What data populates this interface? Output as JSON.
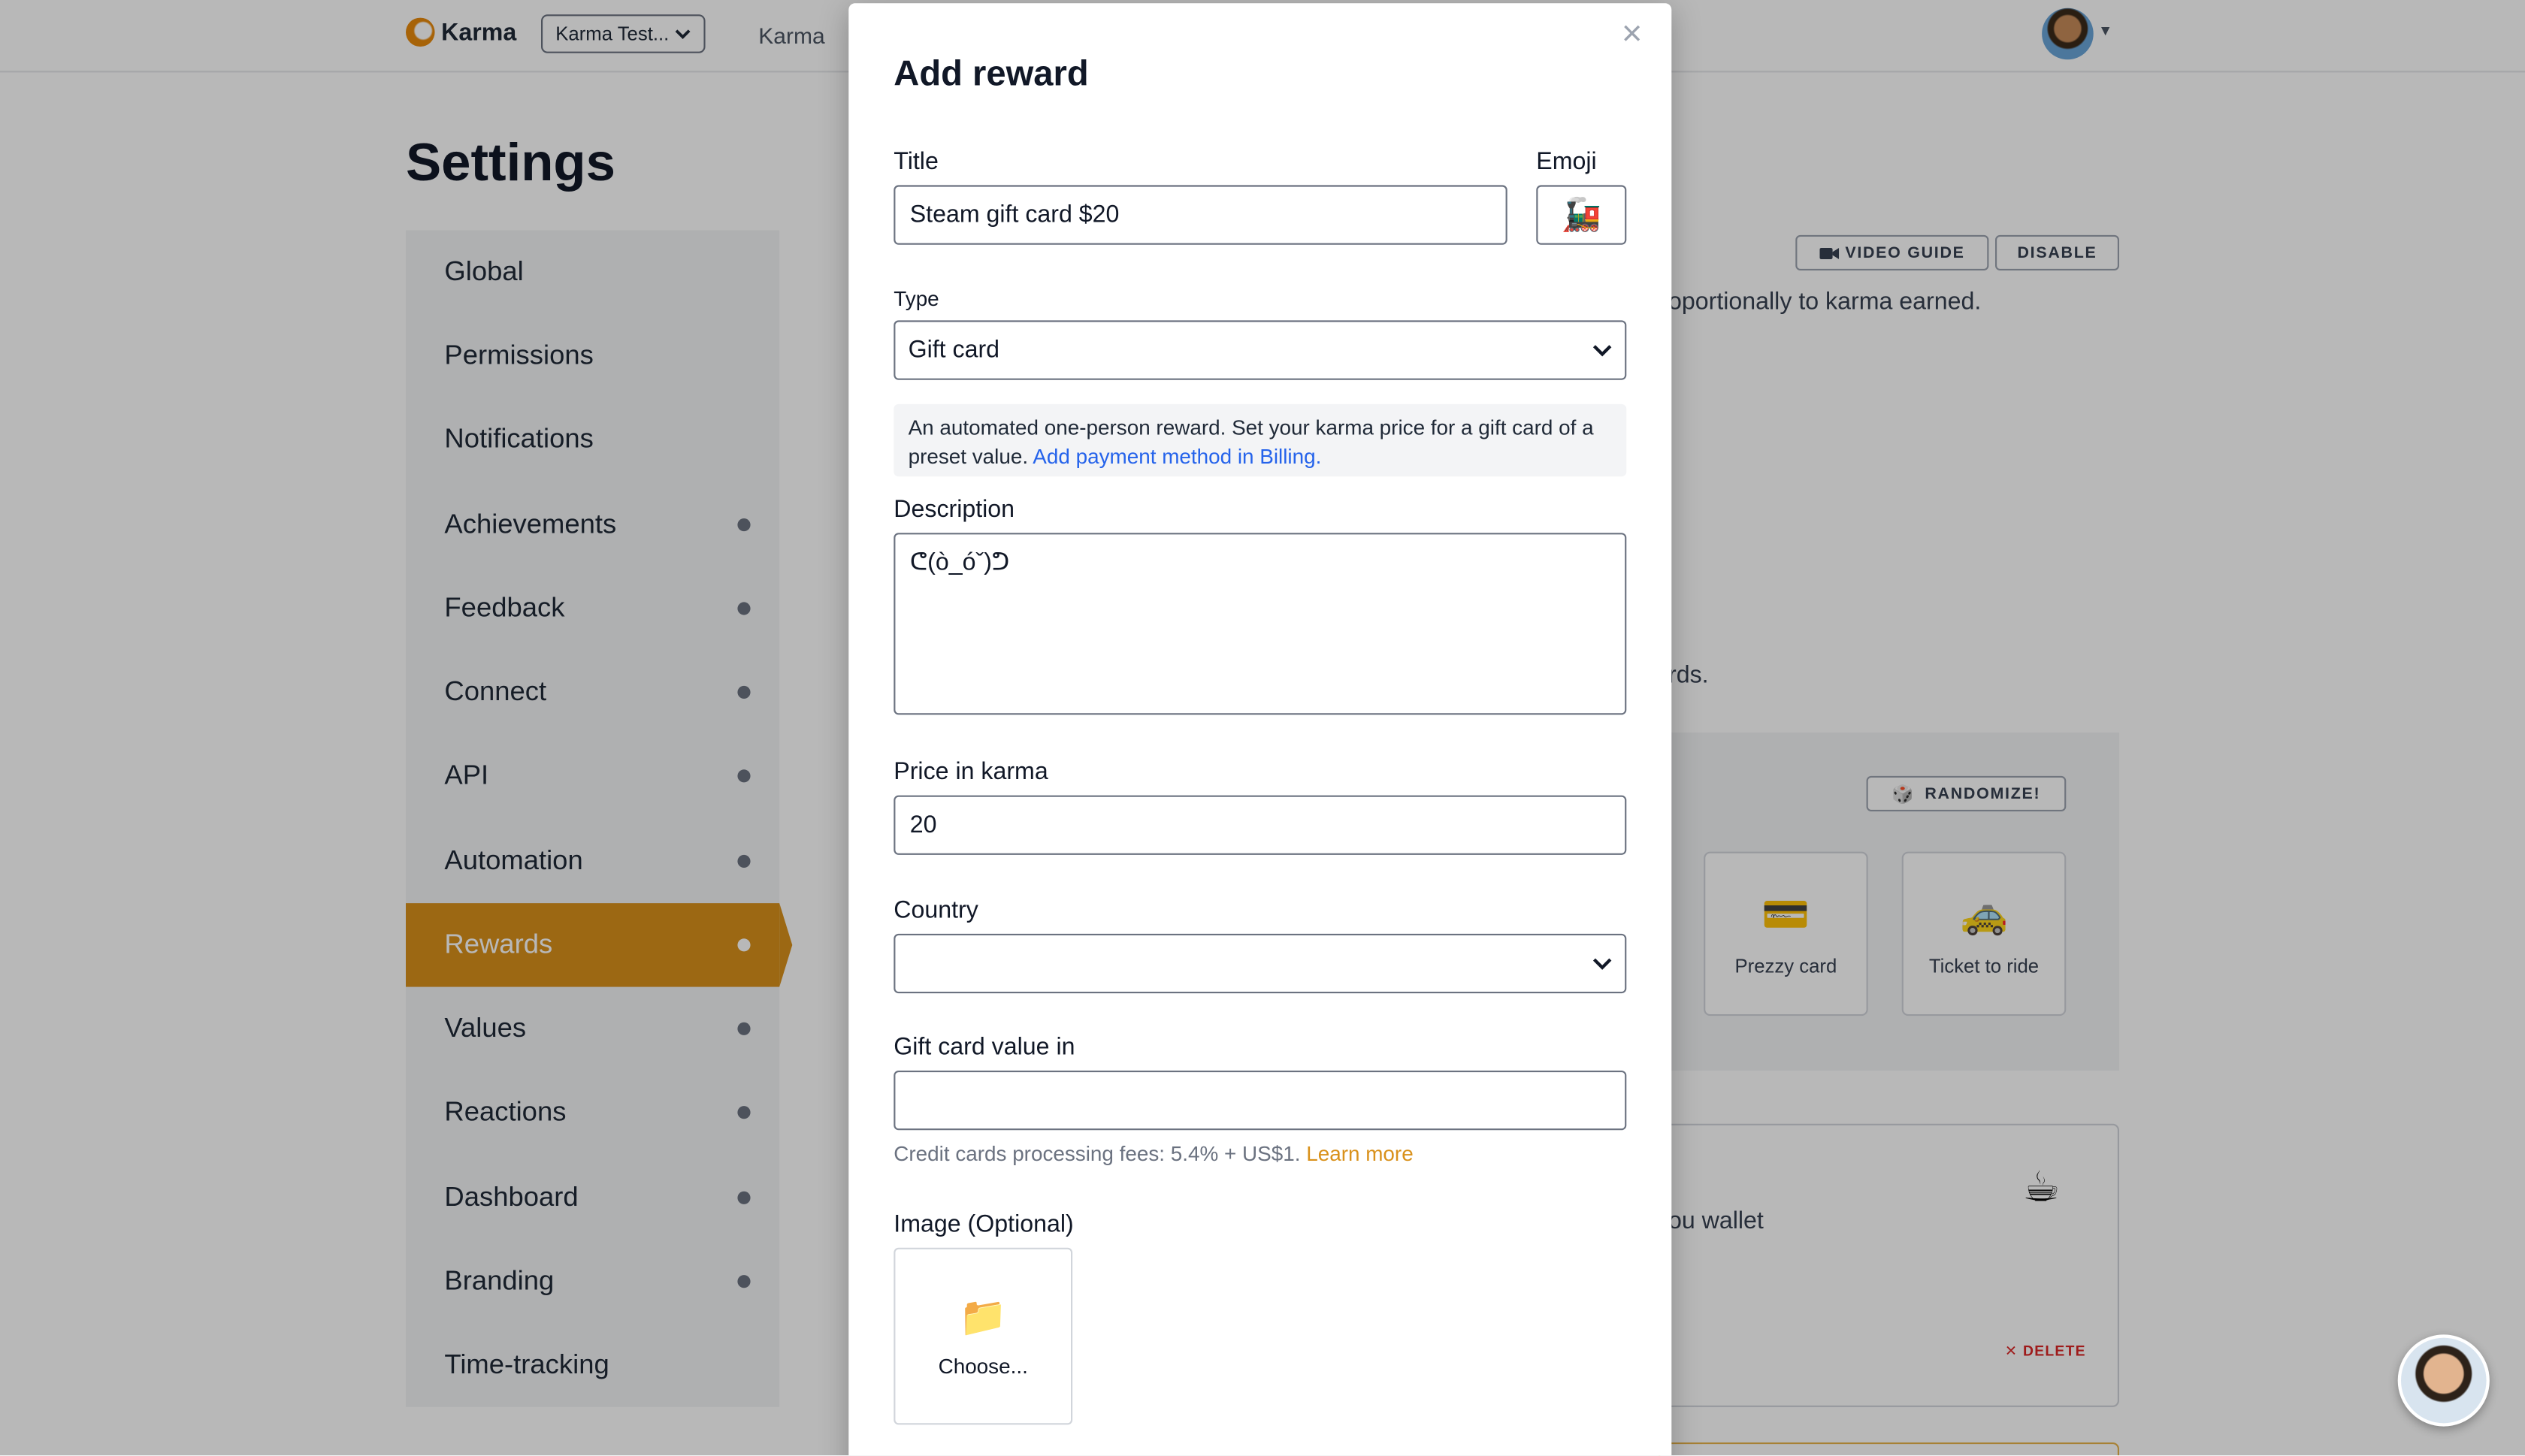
{
  "topbar": {
    "brand": "Karma",
    "team_select": "Karma Test...",
    "nav_link": "Karma"
  },
  "page": {
    "title": "Settings"
  },
  "sidebar": {
    "items": [
      {
        "label": "Global",
        "dot": false
      },
      {
        "label": "Permissions",
        "dot": false
      },
      {
        "label": "Notifications",
        "dot": false
      },
      {
        "label": "Achievements",
        "dot": true
      },
      {
        "label": "Feedback",
        "dot": true
      },
      {
        "label": "Connect",
        "dot": true
      },
      {
        "label": "API",
        "dot": true
      },
      {
        "label": "Automation",
        "dot": true
      },
      {
        "label": "Rewards",
        "dot": true,
        "active": true
      },
      {
        "label": "Values",
        "dot": true
      },
      {
        "label": "Reactions",
        "dot": true
      },
      {
        "label": "Dashboard",
        "dot": true
      },
      {
        "label": "Branding",
        "dot": true
      },
      {
        "label": "Time-tracking",
        "dot": false
      }
    ]
  },
  "background": {
    "video_guide": "VIDEO GUIDE",
    "disable": "DISABLE",
    "text_proportionally": "oportionally to karma earned.",
    "text_rds": "rds.",
    "randomize": "RANDOMIZE!",
    "gift_cards": [
      {
        "label": "Prezzy card",
        "icon": "credit-card-icon"
      },
      {
        "label": "Ticket to ride",
        "icon": "taxi-icon"
      }
    ],
    "wallet_text": "ou wallet",
    "delete_label": "DELETE"
  },
  "modal": {
    "title": "Add reward",
    "close_label": "×",
    "title_label": "Title",
    "title_value": "Steam gift card $20",
    "emoji_label": "Emoji",
    "emoji_value": "🚂",
    "type_label": "Type",
    "type_value": "Gift card",
    "info_text": "An automated one-person reward. Set your karma price for a gift card of a preset value.",
    "info_link": "Add payment method in Billing.",
    "description_label": "Description",
    "description_value": "ᕦ(ò_óˇ)ᕤ",
    "price_label": "Price in karma",
    "price_value": "20",
    "country_label": "Country",
    "country_value": "",
    "gift_value_label": "Gift card value in",
    "gift_value_value": "",
    "fees_text": "Credit cards processing fees: 5.4% + US$1.",
    "fees_link": "Learn more",
    "image_label": "Image (Optional)",
    "image_button": "Choose..."
  },
  "colors": {
    "accent": "#d9911b",
    "link": "#2563eb",
    "delete": "#dc2626"
  }
}
